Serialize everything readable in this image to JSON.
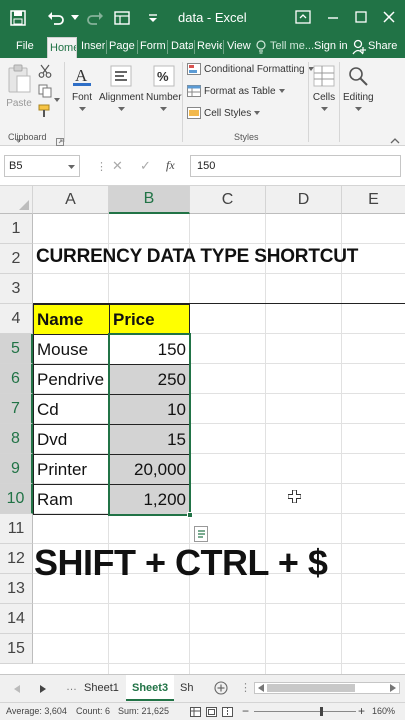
{
  "titlebar": {
    "title": "data - Excel",
    "bg": "#217346"
  },
  "tabs": [
    {
      "label": "File",
      "active": false
    },
    {
      "label": "Home",
      "active": true
    },
    {
      "label": "Insert",
      "active": false
    },
    {
      "label": "Page l",
      "active": false
    },
    {
      "label": "Formu",
      "active": false
    },
    {
      "label": "Data",
      "active": false
    },
    {
      "label": "Revie",
      "active": false
    },
    {
      "label": "View",
      "active": false
    },
    {
      "label": "Tell me...",
      "active": false
    },
    {
      "label": "Sign in",
      "active": false
    },
    {
      "label": "Share",
      "active": false
    }
  ],
  "ribbon": {
    "paste_label": "Paste",
    "clipboard_label": "Clipboard",
    "font_label": "Font",
    "alignment_label": "Alignment",
    "number_label": "Number",
    "conditional_formatting": "Conditional Formatting",
    "format_as_table": "Format as Table",
    "cell_styles": "Cell Styles",
    "styles_label": "Styles",
    "cells_label": "Cells",
    "editing_label": "Editing"
  },
  "formula_bar": {
    "name_box": "B5",
    "cancel_glyph": "✕",
    "enter_glyph": "✓",
    "fx": "fx",
    "value": "150"
  },
  "grid": {
    "columns": [
      "A",
      "B",
      "C",
      "D",
      "E"
    ],
    "rows": [
      "1",
      "2",
      "3",
      "4",
      "5",
      "6",
      "7",
      "8",
      "9",
      "10",
      "11",
      "12",
      "13",
      "14",
      "15"
    ],
    "selected_column": "B",
    "title": "CURRENCY DATA TYPE SHORTCUT",
    "header": {
      "name": "Name",
      "price": "Price"
    },
    "items": [
      {
        "name": "Mouse",
        "price": "150"
      },
      {
        "name": "Pendrive",
        "price": "250"
      },
      {
        "name": "Cd",
        "price": "10"
      },
      {
        "name": "Dvd",
        "price": "15"
      },
      {
        "name": "Printer",
        "price": "20,000"
      },
      {
        "name": "Ram",
        "price": "1,200"
      }
    ],
    "shortcut": "SHIFT + CTRL + $",
    "header_fill": "#ffff00",
    "selection_fill": "#d3d3d3"
  },
  "sheet_tabs": [
    {
      "label": "Sheet1",
      "active": false
    },
    {
      "label": "Sheet3",
      "active": true
    },
    {
      "label": "Sh",
      "active": false
    }
  ],
  "statusbar": {
    "average": "Average: 3,604",
    "count": "Count: 6",
    "sum": "Sum: 21,625",
    "zoom": "160%"
  }
}
